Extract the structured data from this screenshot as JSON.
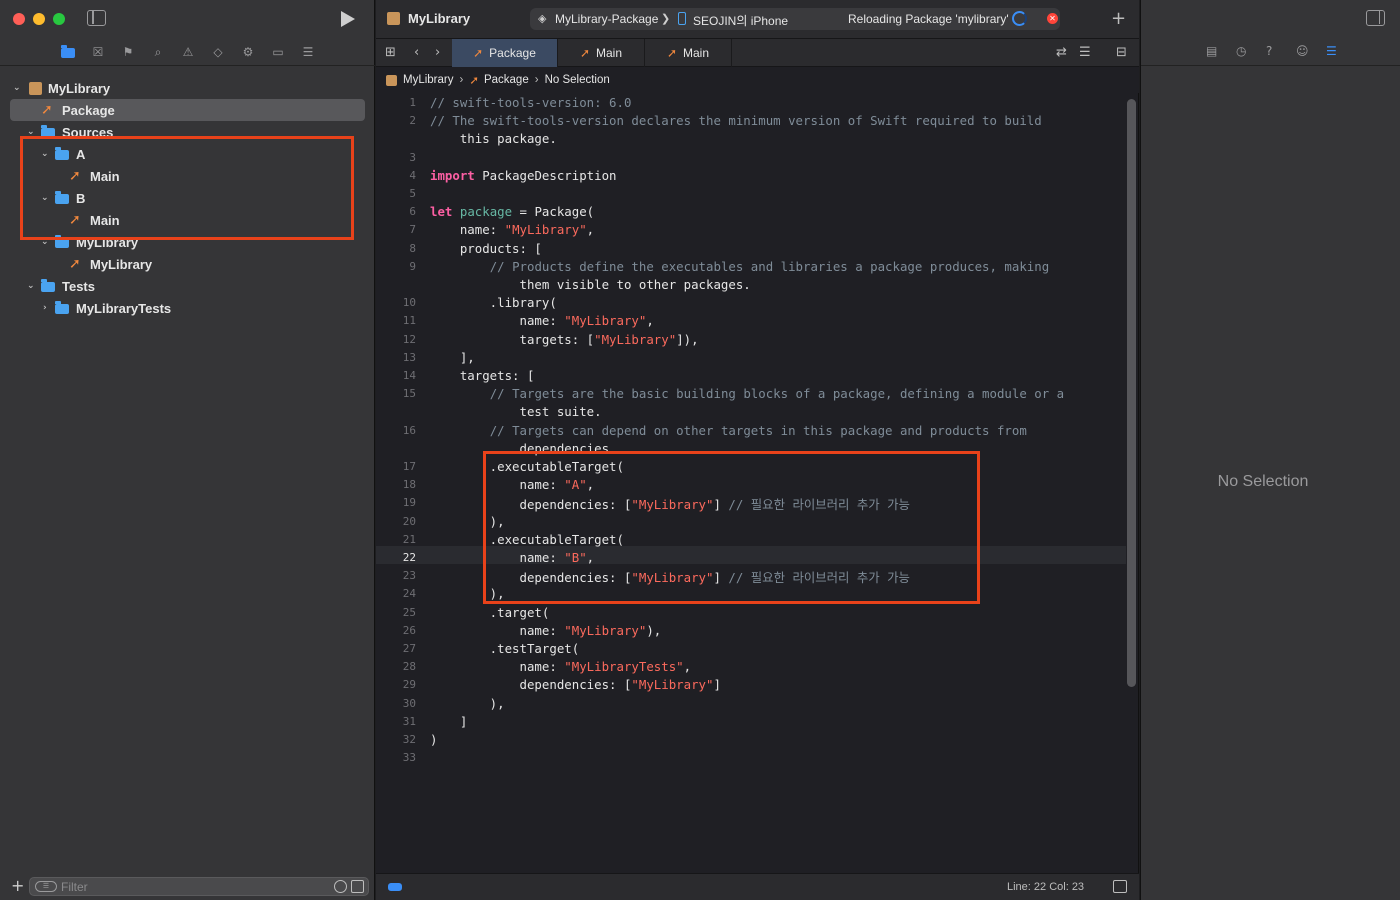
{
  "window": {
    "project_title": "MyLibrary",
    "scheme": "MyLibrary-Package",
    "scheme_separator": "❯",
    "device": "SEOJIN의 iPhone",
    "activity_status": "Reloading Package 'mylibrary'"
  },
  "navigator": {
    "tree": [
      {
        "label": "MyLibrary",
        "icon": "package-icon",
        "expanded": true
      },
      {
        "label": "Package",
        "icon": "swift-file-icon",
        "selected": true
      },
      {
        "label": "Sources",
        "icon": "folder-icon",
        "expanded": true
      },
      {
        "label": "A",
        "icon": "folder-icon",
        "expanded": true
      },
      {
        "label": "Main",
        "icon": "swift-file-icon"
      },
      {
        "label": "B",
        "icon": "folder-icon",
        "expanded": true
      },
      {
        "label": "Main",
        "icon": "swift-file-icon"
      },
      {
        "label": "MyLibrary",
        "icon": "folder-icon",
        "expanded": true
      },
      {
        "label": "MyLibrary",
        "icon": "swift-file-icon"
      },
      {
        "label": "Tests",
        "icon": "folder-icon",
        "expanded": true
      },
      {
        "label": "MyLibraryTests",
        "icon": "folder-icon",
        "expanded": false
      }
    ],
    "filter_placeholder": "Filter"
  },
  "editor": {
    "tabs": [
      {
        "label": "Package",
        "active": true
      },
      {
        "label": "Main",
        "active": false
      },
      {
        "label": "Main",
        "active": false
      }
    ],
    "breadcrumb": [
      "MyLibrary",
      "Package",
      "No Selection"
    ],
    "current_line": 22,
    "lines": [
      {
        "n": "1",
        "text": "// swift-tools-version: 6.0"
      },
      {
        "n": "2",
        "text": "// The swift-tools-version declares the minimum version of Swift required to build"
      },
      {
        "n": "",
        "text": "    this package."
      },
      {
        "n": "3",
        "text": ""
      },
      {
        "n": "4",
        "text": "import PackageDescription"
      },
      {
        "n": "5",
        "text": ""
      },
      {
        "n": "6",
        "text": "let package = Package("
      },
      {
        "n": "7",
        "text": "    name: \"MyLibrary\","
      },
      {
        "n": "8",
        "text": "    products: ["
      },
      {
        "n": "9",
        "text": "        // Products define the executables and libraries a package produces, making"
      },
      {
        "n": "",
        "text": "            them visible to other packages."
      },
      {
        "n": "10",
        "text": "        .library("
      },
      {
        "n": "11",
        "text": "            name: \"MyLibrary\","
      },
      {
        "n": "12",
        "text": "            targets: [\"MyLibrary\"]),"
      },
      {
        "n": "13",
        "text": "    ],"
      },
      {
        "n": "14",
        "text": "    targets: ["
      },
      {
        "n": "15",
        "text": "        // Targets are the basic building blocks of a package, defining a module or a"
      },
      {
        "n": "",
        "text": "            test suite."
      },
      {
        "n": "16",
        "text": "        // Targets can depend on other targets in this package and products from"
      },
      {
        "n": "",
        "text": "            dependencies."
      },
      {
        "n": "17",
        "text": "        .executableTarget("
      },
      {
        "n": "18",
        "text": "            name: \"A\","
      },
      {
        "n": "19",
        "text": "            dependencies: [\"MyLibrary\"] // 필요한 라이브러리 추가 가능"
      },
      {
        "n": "20",
        "text": "        ),"
      },
      {
        "n": "21",
        "text": "        .executableTarget("
      },
      {
        "n": "22",
        "text": "            name: \"B\","
      },
      {
        "n": "23",
        "text": "            dependencies: [\"MyLibrary\"] // 필요한 라이브러리 추가 가능"
      },
      {
        "n": "24",
        "text": "        ),"
      },
      {
        "n": "25",
        "text": "        .target("
      },
      {
        "n": "26",
        "text": "            name: \"MyLibrary\"),"
      },
      {
        "n": "27",
        "text": "        .testTarget("
      },
      {
        "n": "28",
        "text": "            name: \"MyLibraryTests\","
      },
      {
        "n": "29",
        "text": "            dependencies: [\"MyLibrary\"]"
      },
      {
        "n": "30",
        "text": "        ),"
      },
      {
        "n": "31",
        "text": "    ]"
      },
      {
        "n": "32",
        "text": ")"
      },
      {
        "n": "33",
        "text": ""
      }
    ],
    "status": "Line: 22  Col: 23"
  },
  "inspector": {
    "empty_text": "No Selection"
  },
  "colors": {
    "annotation_box": "#e8421a",
    "accent": "#3a8ef6",
    "swift_icon": "#f0883e",
    "folder_icon": "#4aa3f0"
  }
}
